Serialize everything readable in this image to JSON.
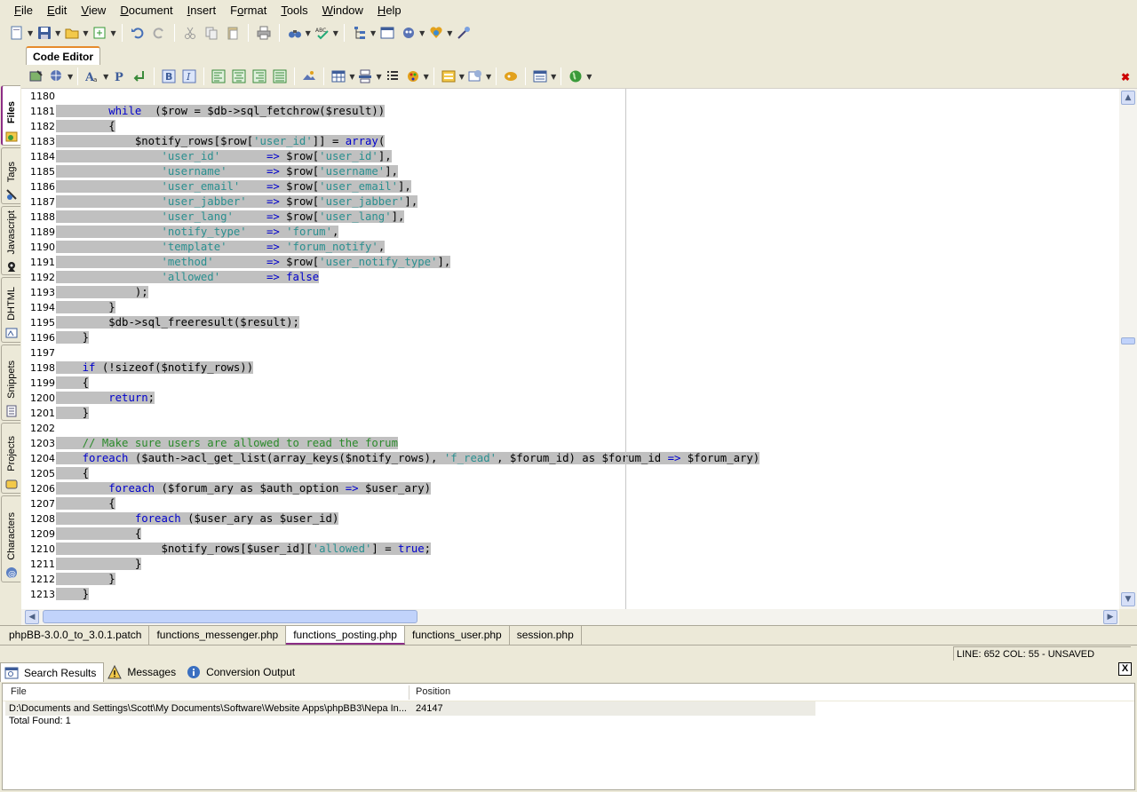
{
  "menu": [
    "File",
    "Edit",
    "View",
    "Document",
    "Insert",
    "Format",
    "Tools",
    "Window",
    "Help"
  ],
  "menu_mnemonics": [
    "F",
    "E",
    "V",
    "D",
    "I",
    "o",
    "T",
    "W",
    "H"
  ],
  "editor_tab": "Code Editor",
  "side_tabs": [
    "Files",
    "Tags",
    "Javascript",
    "DHTML",
    "Snippets",
    "Projects",
    "Characters"
  ],
  "line_numbers": [
    "1180",
    "1181",
    "1182",
    "1183",
    "1184",
    "1185",
    "1186",
    "1187",
    "1188",
    "1189",
    "1190",
    "1191",
    "1192",
    "1193",
    "1194",
    "1195",
    "1196",
    "1197",
    "1198",
    "1199",
    "1200",
    "1201",
    "1202",
    "1203",
    "1204",
    "1205",
    "1206",
    "1207",
    "1208",
    "1209",
    "1210",
    "1211",
    "1212",
    "1213"
  ],
  "code_lines": [
    [],
    [
      [
        "sp",
        "\t\t"
      ],
      [
        "kw",
        "while"
      ],
      [
        "",
        "  ($row = $db->sql_fetchrow($result))"
      ]
    ],
    [
      [
        "sp",
        "\t\t"
      ],
      [
        "",
        "{"
      ]
    ],
    [
      [
        "sp",
        "\t\t\t"
      ],
      [
        "",
        "$notify_rows[$row["
      ],
      [
        "str",
        "'user_id'"
      ],
      [
        "",
        "]] = "
      ],
      [
        "kw",
        "array"
      ],
      [
        "",
        "("
      ]
    ],
    [
      [
        "sp",
        "\t\t\t\t"
      ],
      [
        "str",
        "'user_id'"
      ],
      [
        "",
        "       "
      ],
      [
        "kw",
        "=>"
      ],
      [
        "",
        " $row["
      ],
      [
        "str",
        "'user_id'"
      ],
      [
        "",
        "],"
      ]
    ],
    [
      [
        "sp",
        "\t\t\t\t"
      ],
      [
        "str",
        "'username'"
      ],
      [
        "",
        "      "
      ],
      [
        "kw",
        "=>"
      ],
      [
        "",
        " $row["
      ],
      [
        "str",
        "'username'"
      ],
      [
        "",
        "],"
      ]
    ],
    [
      [
        "sp",
        "\t\t\t\t"
      ],
      [
        "str",
        "'user_email'"
      ],
      [
        "",
        "    "
      ],
      [
        "kw",
        "=>"
      ],
      [
        "",
        " $row["
      ],
      [
        "str",
        "'user_email'"
      ],
      [
        "",
        "],"
      ]
    ],
    [
      [
        "sp",
        "\t\t\t\t"
      ],
      [
        "str",
        "'user_jabber'"
      ],
      [
        "",
        "   "
      ],
      [
        "kw",
        "=>"
      ],
      [
        "",
        " $row["
      ],
      [
        "str",
        "'user_jabber'"
      ],
      [
        "",
        "],"
      ]
    ],
    [
      [
        "sp",
        "\t\t\t\t"
      ],
      [
        "str",
        "'user_lang'"
      ],
      [
        "",
        "     "
      ],
      [
        "kw",
        "=>"
      ],
      [
        "",
        " $row["
      ],
      [
        "str",
        "'user_lang'"
      ],
      [
        "",
        "],"
      ]
    ],
    [
      [
        "sp",
        "\t\t\t\t"
      ],
      [
        "str",
        "'notify_type'"
      ],
      [
        "",
        "   "
      ],
      [
        "kw",
        "=>"
      ],
      [
        "",
        " "
      ],
      [
        "str",
        "'forum'"
      ],
      [
        "",
        ","
      ]
    ],
    [
      [
        "sp",
        "\t\t\t\t"
      ],
      [
        "str",
        "'template'"
      ],
      [
        "",
        "      "
      ],
      [
        "kw",
        "=>"
      ],
      [
        "",
        " "
      ],
      [
        "str",
        "'forum_notify'"
      ],
      [
        "",
        ","
      ]
    ],
    [
      [
        "sp",
        "\t\t\t\t"
      ],
      [
        "str",
        "'method'"
      ],
      [
        "",
        "        "
      ],
      [
        "kw",
        "=>"
      ],
      [
        "",
        " $row["
      ],
      [
        "str",
        "'user_notify_type'"
      ],
      [
        "",
        "],"
      ]
    ],
    [
      [
        "sp",
        "\t\t\t\t"
      ],
      [
        "str",
        "'allowed'"
      ],
      [
        "",
        "       "
      ],
      [
        "kw",
        "=>"
      ],
      [
        "",
        " "
      ],
      [
        "kw",
        "false"
      ]
    ],
    [
      [
        "sp",
        "\t\t\t"
      ],
      [
        "",
        ");"
      ]
    ],
    [
      [
        "sp",
        "\t\t"
      ],
      [
        "",
        "}"
      ]
    ],
    [
      [
        "sp",
        "\t\t"
      ],
      [
        "",
        "$db->sql_freeresult($result);"
      ]
    ],
    [
      [
        "sp",
        "\t"
      ],
      [
        "",
        "}"
      ]
    ],
    [],
    [
      [
        "sp",
        "\t"
      ],
      [
        "kw",
        "if"
      ],
      [
        "",
        " (!sizeof($notify_rows))"
      ]
    ],
    [
      [
        "sp",
        "\t"
      ],
      [
        "",
        "{"
      ]
    ],
    [
      [
        "sp",
        "\t\t"
      ],
      [
        "kw",
        "return"
      ],
      [
        "",
        ";"
      ]
    ],
    [
      [
        "sp",
        "\t"
      ],
      [
        "",
        "}"
      ]
    ],
    [],
    [
      [
        "sp",
        "\t"
      ],
      [
        "cm",
        "// Make sure users are allowed to read the forum"
      ]
    ],
    [
      [
        "sp",
        "\t"
      ],
      [
        "kw",
        "foreach"
      ],
      [
        "",
        " ($auth->acl_get_list(array_keys($notify_rows), "
      ],
      [
        "str",
        "'f_read'"
      ],
      [
        "",
        ", $forum_id) as $forum_id "
      ],
      [
        "kw",
        "=>"
      ],
      [
        "",
        " $forum_ary)"
      ]
    ],
    [
      [
        "sp",
        "\t"
      ],
      [
        "",
        "{"
      ]
    ],
    [
      [
        "sp",
        "\t\t"
      ],
      [
        "kw",
        "foreach"
      ],
      [
        "",
        " ($forum_ary as $auth_option "
      ],
      [
        "kw",
        "=>"
      ],
      [
        "",
        " $user_ary)"
      ]
    ],
    [
      [
        "sp",
        "\t\t"
      ],
      [
        "",
        "{"
      ]
    ],
    [
      [
        "sp",
        "\t\t\t"
      ],
      [
        "kw",
        "foreach"
      ],
      [
        "",
        " ($user_ary as $user_id)"
      ]
    ],
    [
      [
        "sp",
        "\t\t\t"
      ],
      [
        "",
        "{"
      ]
    ],
    [
      [
        "sp",
        "\t\t\t\t"
      ],
      [
        "",
        "$notify_rows[$user_id]["
      ],
      [
        "str",
        "'allowed'"
      ],
      [
        "",
        "] = "
      ],
      [
        "kw",
        "true"
      ],
      [
        "",
        ";"
      ]
    ],
    [
      [
        "sp",
        "\t\t\t"
      ],
      [
        "",
        "}"
      ]
    ],
    [
      [
        "sp",
        "\t\t"
      ],
      [
        "",
        "}"
      ]
    ],
    [
      [
        "sp",
        "\t"
      ],
      [
        "",
        "}"
      ]
    ]
  ],
  "file_tabs": [
    "phpBB-3.0.0_to_3.0.1.patch",
    "functions_messenger.php",
    "functions_posting.php",
    "functions_user.php",
    "session.php"
  ],
  "active_file_tab": 2,
  "status": "LINE: 652  COL: 55 - UNSAVED",
  "bottom_tabs": [
    "Search Results",
    "Messages",
    "Conversion Output"
  ],
  "results": {
    "col_file": "File",
    "col_position": "Position",
    "rows": [
      {
        "file": "D:\\Documents and Settings\\Scott\\My Documents\\Software\\Website Apps\\phpBB3\\Nepa In...",
        "position": "24147"
      }
    ],
    "total": "Total Found: 1"
  },
  "colors": {
    "keyword": "#0000cc",
    "string": "#2a8f8f",
    "comment": "#2b8a2b",
    "selection": "#c0c0c0",
    "accent": "#8c2d86"
  }
}
